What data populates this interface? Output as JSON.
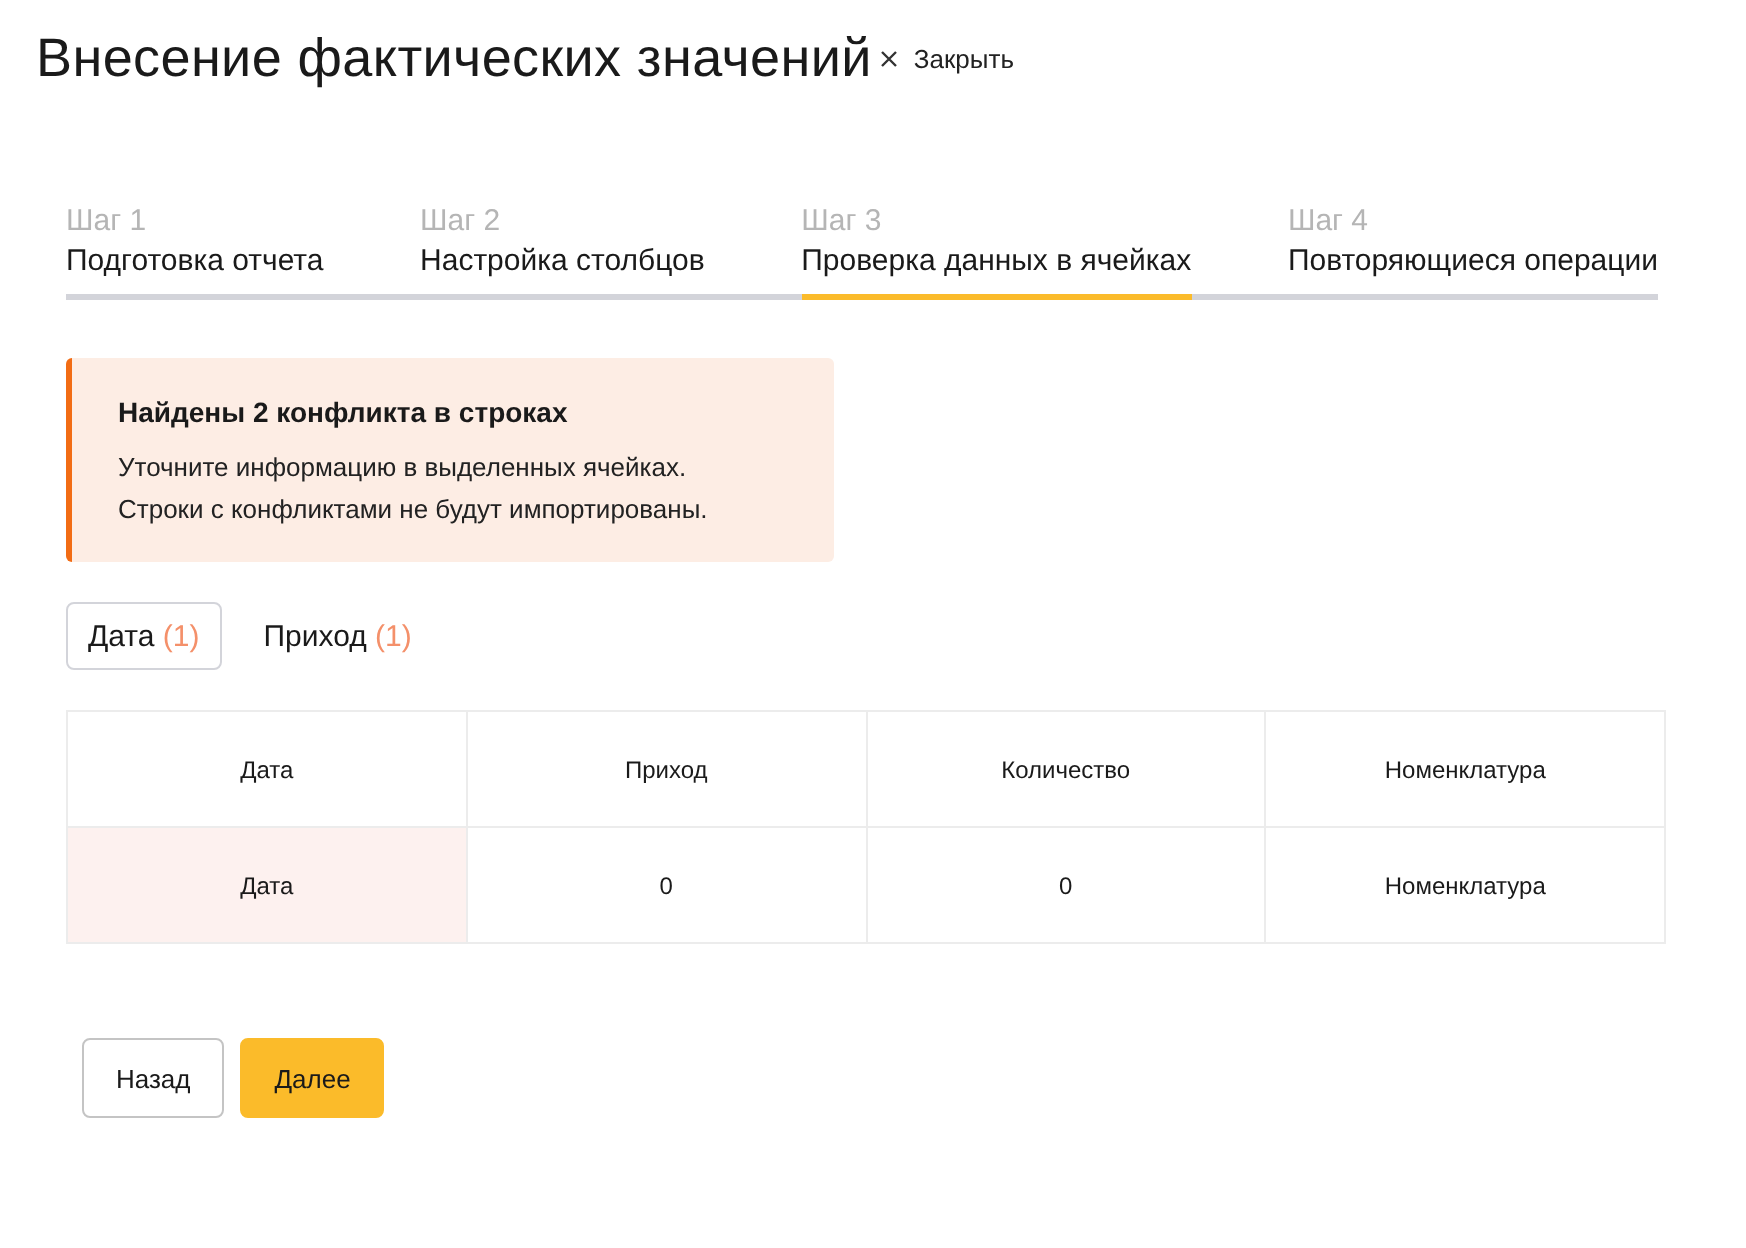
{
  "header": {
    "title": "Внесение фактических значений",
    "close_label": "Закрыть"
  },
  "steps": [
    {
      "step": "Шаг 1",
      "label": "Подготовка отчета",
      "selected": false
    },
    {
      "step": "Шаг 2",
      "label": "Настройка столбцов",
      "selected": false
    },
    {
      "step": "Шаг 3",
      "label": "Проверка данных в ячейках",
      "selected": true
    },
    {
      "step": "Шаг 4",
      "label": "Повторяющиеся операции",
      "selected": false
    }
  ],
  "alert": {
    "title": "Найдены 2 конфликта в строках",
    "lines": [
      "Уточните информацию в выделенных ячейках.",
      "Строки с конфликтами не будут импортированы."
    ]
  },
  "filters": [
    {
      "label": "Дата",
      "count": "(1)",
      "selected": true
    },
    {
      "label": "Приход",
      "count": "(1)",
      "selected": false
    }
  ],
  "table": {
    "columns": [
      "Дата",
      "Приход",
      "Количество",
      "Номенклатура"
    ],
    "rows": [
      {
        "cells": [
          {
            "text": "Дата",
            "conflict": true
          },
          {
            "text": "0",
            "conflict": false
          },
          {
            "text": "0",
            "conflict": false
          },
          {
            "text": "Номенклатура",
            "conflict": false
          }
        ]
      }
    ]
  },
  "buttons": [
    {
      "label": "Назад",
      "kind": "secondary"
    },
    {
      "label": "Далее",
      "kind": "primary"
    }
  ]
}
